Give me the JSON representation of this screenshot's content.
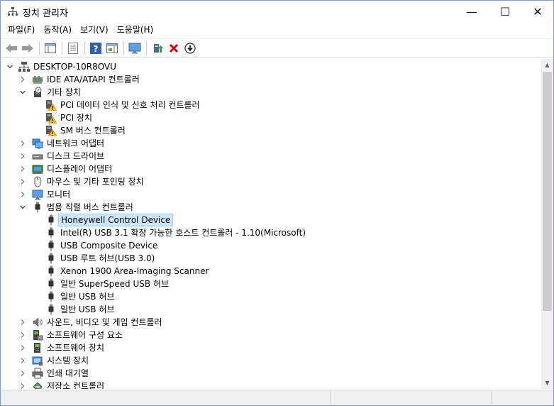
{
  "window": {
    "title": "장치 관리자",
    "close_glyph": "✕",
    "max_glyph": "☐",
    "min_glyph": "—"
  },
  "menu": [
    "파일(F)",
    "동작(A)",
    "보기(V)",
    "도움말(H)"
  ],
  "toolbar": [
    "back-icon",
    "forward-icon",
    "properties-pane-icon",
    "list-icon",
    "help-icon",
    "panel-icon",
    "monitor-icon",
    "update-driver-icon",
    "uninstall-icon",
    "download-icon"
  ],
  "tree": {
    "root": "DESKTOP-10R8OVU",
    "items": [
      {
        "label": "IDE ATA/ATAPI 컨트롤러",
        "level": 1,
        "state": "collapsed",
        "icon": "ide-controller-icon"
      },
      {
        "label": "기타 장치",
        "level": 1,
        "state": "expanded",
        "icon": "other-devices-icon"
      },
      {
        "label": "PCI 데이터 인식 및 신호 처리 컨트롤러",
        "level": 2,
        "state": "leaf",
        "icon": "warning-device-icon"
      },
      {
        "label": "PCI 장치",
        "level": 2,
        "state": "leaf",
        "icon": "warning-device-icon"
      },
      {
        "label": "SM 버스 컨트롤러",
        "level": 2,
        "state": "leaf",
        "icon": "warning-device-icon"
      },
      {
        "label": "네트워크 어댑터",
        "level": 1,
        "state": "collapsed",
        "icon": "network-adapter-icon"
      },
      {
        "label": "디스크 드라이브",
        "level": 1,
        "state": "collapsed",
        "icon": "disk-drive-icon"
      },
      {
        "label": "디스플레이 어댑터",
        "level": 1,
        "state": "collapsed",
        "icon": "display-adapter-icon"
      },
      {
        "label": "마우스 및 기타 포인팅 장치",
        "level": 1,
        "state": "collapsed",
        "icon": "mouse-icon"
      },
      {
        "label": "모니터",
        "level": 1,
        "state": "collapsed",
        "icon": "monitor-icon"
      },
      {
        "label": "범용 직렬 버스 컨트롤러",
        "level": 1,
        "state": "expanded",
        "icon": "usb-icon"
      },
      {
        "label": "Honeywell Control Device",
        "level": 2,
        "state": "leaf",
        "icon": "usb-icon",
        "selected": true
      },
      {
        "label": "Intel(R) USB 3.1 확장 가능한 호스트 컨트롤러 - 1.10(Microsoft)",
        "level": 2,
        "state": "leaf",
        "icon": "usb-icon"
      },
      {
        "label": "USB Composite Device",
        "level": 2,
        "state": "leaf",
        "icon": "usb-icon"
      },
      {
        "label": "USB 루트 허브(USB 3.0)",
        "level": 2,
        "state": "leaf",
        "icon": "usb-icon"
      },
      {
        "label": "Xenon 1900 Area-Imaging Scanner",
        "level": 2,
        "state": "leaf",
        "icon": "usb-icon"
      },
      {
        "label": "일반 SuperSpeed USB 허브",
        "level": 2,
        "state": "leaf",
        "icon": "usb-icon"
      },
      {
        "label": "일반 USB 허브",
        "level": 2,
        "state": "leaf",
        "icon": "usb-icon"
      },
      {
        "label": "일반 USB 허브",
        "level": 2,
        "state": "leaf",
        "icon": "usb-icon"
      },
      {
        "label": "사운드, 비디오 및 게임 컨트롤러",
        "level": 1,
        "state": "collapsed",
        "icon": "speaker-icon"
      },
      {
        "label": "소프트웨어 구성 요소",
        "level": 1,
        "state": "collapsed",
        "icon": "software-component-icon"
      },
      {
        "label": "소프트웨어 장치",
        "level": 1,
        "state": "collapsed",
        "icon": "software-device-icon"
      },
      {
        "label": "시스템 장치",
        "level": 1,
        "state": "collapsed",
        "icon": "system-device-icon"
      },
      {
        "label": "인쇄 대기열",
        "level": 1,
        "state": "collapsed",
        "icon": "printer-icon"
      },
      {
        "label": "저장소 컨트롤러",
        "level": 1,
        "state": "collapsed",
        "icon": "storage-controller-icon"
      }
    ]
  },
  "colors": {
    "selection_bg": "#cce8ff",
    "selection_border": "#99d1ff",
    "warning": "#f5c400",
    "close_red": "#d40000"
  }
}
